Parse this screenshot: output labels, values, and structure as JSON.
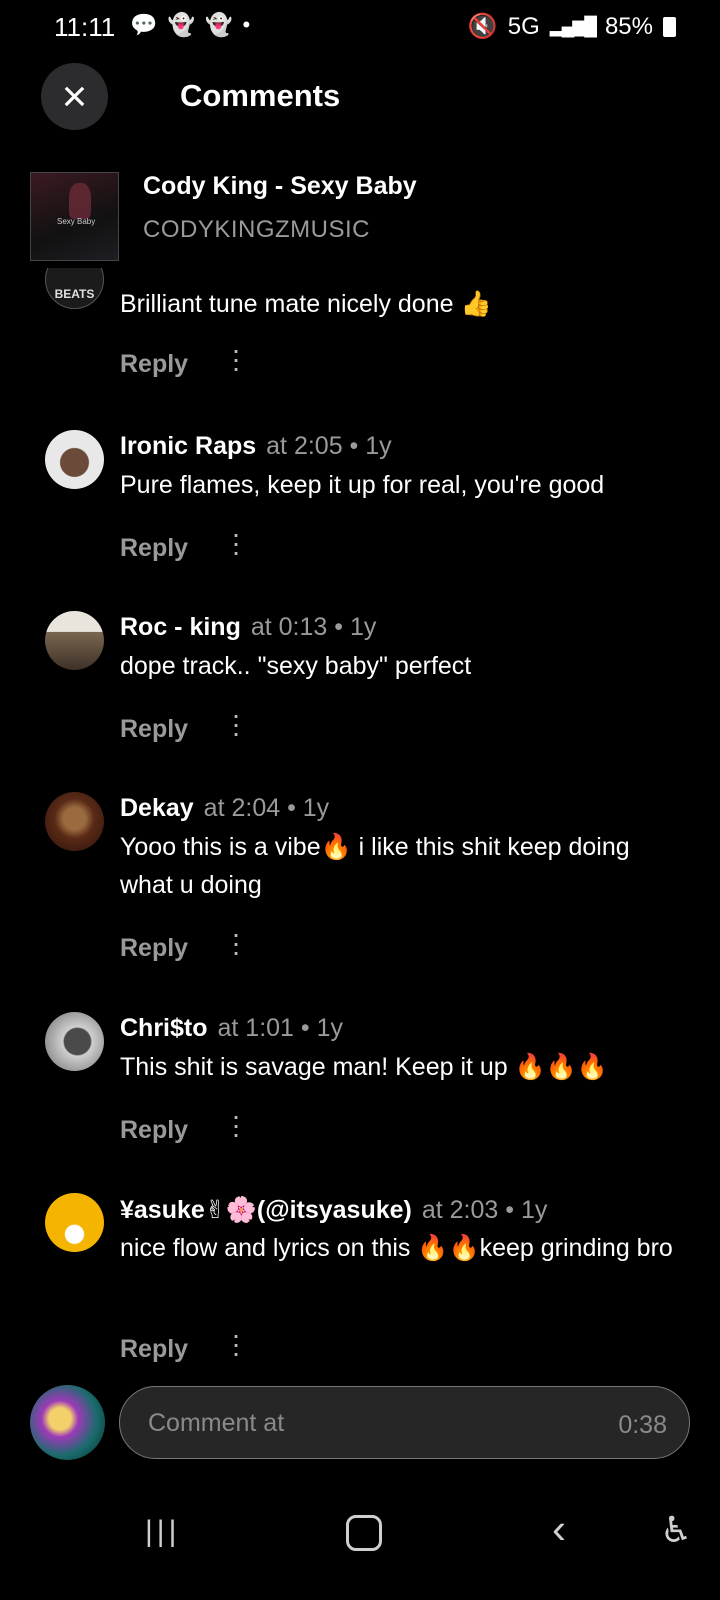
{
  "status_bar": {
    "time": "11:11",
    "notification_icons": "💬 👻 👻 •",
    "signal": "5G",
    "battery": "85%"
  },
  "header": {
    "title": "Comments",
    "close_icon": "×"
  },
  "track": {
    "title": "Cody King - Sexy Baby",
    "artist": "CODYKINGZMUSIC",
    "art_text": "Sexy Baby"
  },
  "comments": [
    {
      "text": "Brilliant tune mate nicely done 👍",
      "avatar_text": "BEATS",
      "reply_label": "Reply"
    },
    {
      "user": "Ironic Raps",
      "time": "at 2:05 • 1y",
      "text": "Pure flames, keep it up for real, you're good",
      "reply_label": "Reply"
    },
    {
      "user": "Roc - king",
      "time": "at 0:13 • 1y",
      "text": "dope track.. \"sexy baby\" perfect",
      "reply_label": "Reply"
    },
    {
      "user": "Dekay",
      "time": "at 2:04 • 1y",
      "text": "Yooo this is a vibe🔥 i like this shit keep doing what u doing",
      "reply_label": "Reply"
    },
    {
      "user": "Chri$to",
      "time": "at 1:01 • 1y",
      "text": "This shit is savage man! Keep it up 🔥🔥🔥",
      "reply_label": "Reply"
    },
    {
      "user": "¥asuke✌🌸(@itsyasuke)",
      "time": "at 2:03 • 1y",
      "text": "nice flow and lyrics on this 🔥🔥keep grinding bro",
      "reply_label": "Reply"
    }
  ],
  "comment_input": {
    "placeholder": "Comment at",
    "timestamp": "0:38"
  },
  "nav": {
    "recent": "|||",
    "back": "‹",
    "accessibility": "♿"
  }
}
